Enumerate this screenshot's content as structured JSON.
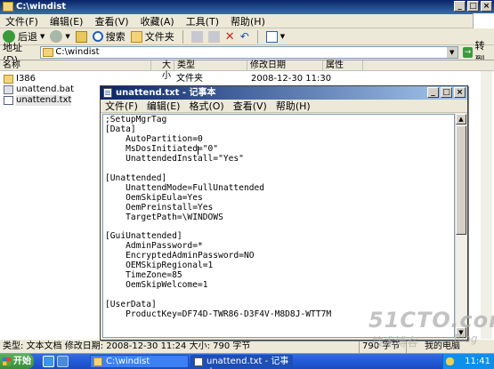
{
  "explorer": {
    "title": "C:\\windist",
    "menu": [
      "文件(F)",
      "编辑(E)",
      "查看(V)",
      "收藏(A)",
      "工具(T)",
      "帮助(H)"
    ],
    "toolbar": {
      "back": "后退",
      "search": "搜索",
      "folders": "文件夹"
    },
    "address": {
      "label": "地址(D)",
      "value": "C:\\windist",
      "go": "转到"
    },
    "columns": [
      "名称",
      "大小",
      "类型",
      "修改日期",
      "属性"
    ],
    "files": [
      {
        "name": "I386",
        "type": "文件夹",
        "date": "2008-12-30 11:30",
        "attr": ""
      },
      {
        "name": "unattend.bat",
        "type": "",
        "date": "",
        "attr": ""
      },
      {
        "name": "unattend.txt",
        "type": "",
        "date": "",
        "attr": ""
      }
    ],
    "status": {
      "text": "类型: 文本文档 修改日期: 2008-12-30 11:24 大小: 790 字节",
      "size": "790 字节",
      "location": "我的电脑"
    }
  },
  "notepad": {
    "title": "unattend.txt - 记事本",
    "menu": [
      "文件(F)",
      "编辑(E)",
      "格式(O)",
      "查看(V)",
      "帮助(H)"
    ],
    "content": ";SetupMgrTag\n[Data]\n    AutoPartition=0\n    MsDosInitiated=\"0\"\n    UnattendedInstall=\"Yes\"\n\n[Unattended]\n    UnattendMode=FullUnattended\n    OemSkipEula=Yes\n    OemPreinstall=Yes\n    TargetPath=\\WINDOWS\n\n[GuiUnattended]\n    AdminPassword=*\n    EncryptedAdminPassword=NO\n    OEMSkipRegional=1\n    TimeZone=85\n    OemSkipWelcome=1\n\n[UserData]\n    ProductKey=DF74D-TWR86-D3F4V-M8D8J-WTT7M"
  },
  "taskbar": {
    "start": "开始",
    "tasks": [
      "C:\\windist",
      "unattend.txt - 记事本"
    ],
    "clock": "11:41"
  },
  "watermark": {
    "brand": "51CTO.com",
    "sub": "技术博客",
    "blog": "Blog"
  },
  "colors": {
    "titlebar": "#0A246A",
    "taskbar": "#245EDB",
    "start": "#3A8D3A"
  },
  "icons": [
    "window-folder-icon",
    "minimize-icon",
    "maximize-icon",
    "close-icon",
    "back-icon",
    "forward-icon",
    "up-icon",
    "search-icon",
    "folders-icon",
    "delete-icon",
    "views-icon",
    "go-icon",
    "folder-icon",
    "bat-file-icon",
    "txt-file-icon",
    "notepad-icon",
    "windows-logo-icon",
    "ie-icon",
    "desktop-icon",
    "tray-icon"
  ]
}
